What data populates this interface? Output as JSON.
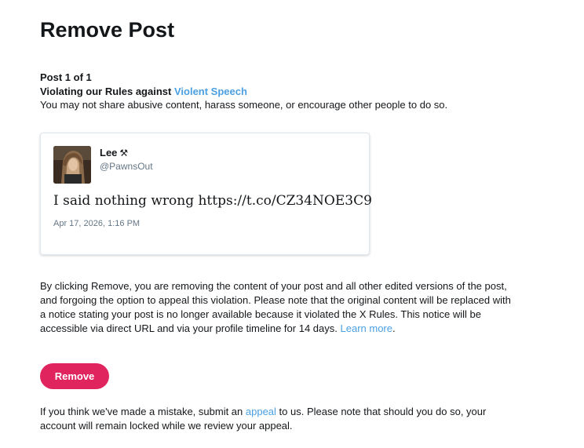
{
  "page": {
    "title": "Remove Post"
  },
  "post_counter": "Post 1 of 1",
  "violation": {
    "prefix": "Violating our Rules against ",
    "rule_name": "Violent Speech",
    "description": "You may not share abusive content, harass someone, or encourage other people to do so."
  },
  "post": {
    "author_name": "Lee",
    "author_badge_icon": "pin-icon",
    "author_badge_glyph": "⚒",
    "author_handle": "@PawnsOut",
    "text": "I said nothing wrong https://t.co/CZ34NOE3C9",
    "timestamp": "Apr 17, 2026, 1:16 PM"
  },
  "notice": {
    "body": "By clicking Remove, you are removing the content of your post and all other edited versions of the post, and forgoing the option to appeal this violation. Please note that the original content will be replaced with a notice stating your post is no longer available because it violated the X Rules. This notice will be accessible via direct URL and via your profile timeline for 14 days.",
    "learn_more": "Learn more",
    "learn_more_suffix": "."
  },
  "actions": {
    "remove_label": "Remove"
  },
  "appeal": {
    "prefix": "If you think we've made a mistake, submit an ",
    "link_text": "appeal",
    "suffix": " to us. Please note that should you do so, your account will remain locked while we review your appeal."
  },
  "colors": {
    "link": "#4a9fe0",
    "remove_button": "#e0245e",
    "muted_text": "#657786",
    "primary_text": "#14171a"
  }
}
